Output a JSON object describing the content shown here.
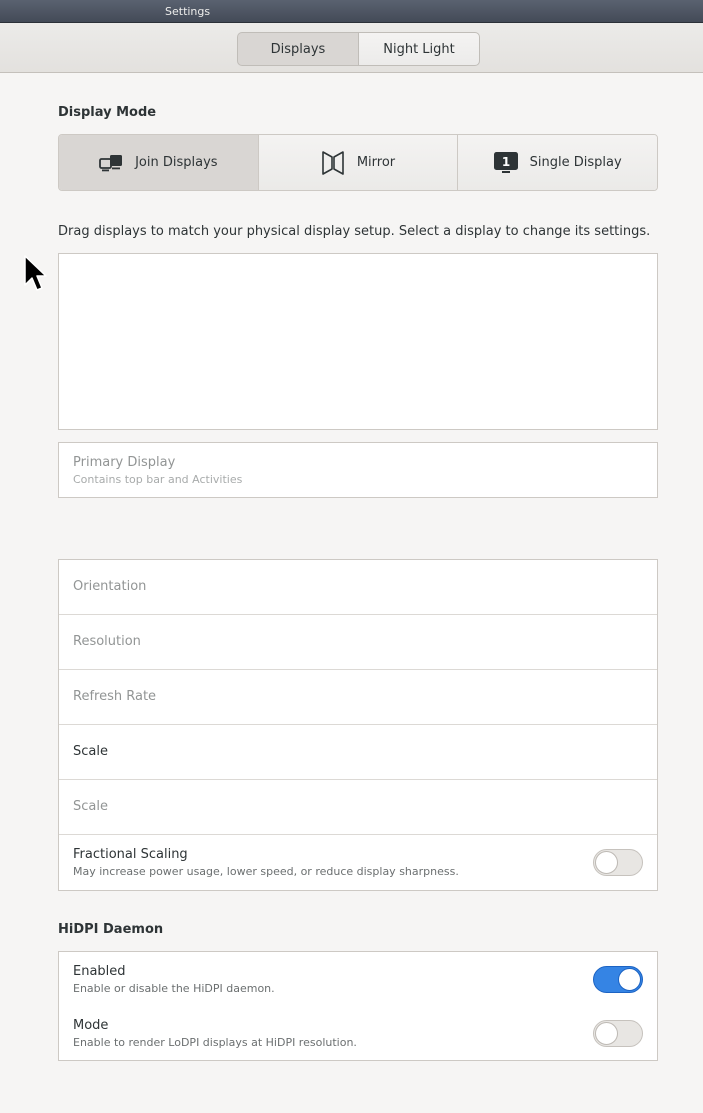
{
  "window": {
    "title": "Settings"
  },
  "header": {
    "tabs": [
      {
        "label": "Displays"
      },
      {
        "label": "Night Light"
      }
    ]
  },
  "display_mode": {
    "title": "Display Mode",
    "modes": [
      {
        "label": "Join Displays",
        "icon": "join-displays-icon",
        "selected": true
      },
      {
        "label": "Mirror",
        "icon": "mirror-icon",
        "selected": false
      },
      {
        "label": "Single Display",
        "icon": "single-display-icon",
        "selected": false
      }
    ]
  },
  "arrangement": {
    "help": "Drag displays to match your physical display setup. Select a display to change its settings."
  },
  "primary_display": {
    "label": "Primary Display",
    "description": "Contains top bar and Activities"
  },
  "settings": {
    "orientation": "Orientation",
    "resolution": "Resolution",
    "refresh_rate": "Refresh Rate",
    "scale": "Scale",
    "scale_dim": "Scale",
    "fractional_scaling": {
      "label": "Fractional Scaling",
      "description": "May increase power usage, lower speed, or reduce display sharpness.",
      "enabled": false
    }
  },
  "hidpi": {
    "title": "HiDPI Daemon",
    "enabled": {
      "label": "Enabled",
      "description": "Enable or disable the HiDPI daemon.",
      "value": true
    },
    "mode": {
      "label": "Mode",
      "description": "Enable to render LoDPI displays at HiDPI resolution.",
      "value": false
    }
  },
  "colors": {
    "accent": "#3584e4",
    "window_bg": "#f6f5f4",
    "titlebar": "#4c5361"
  }
}
